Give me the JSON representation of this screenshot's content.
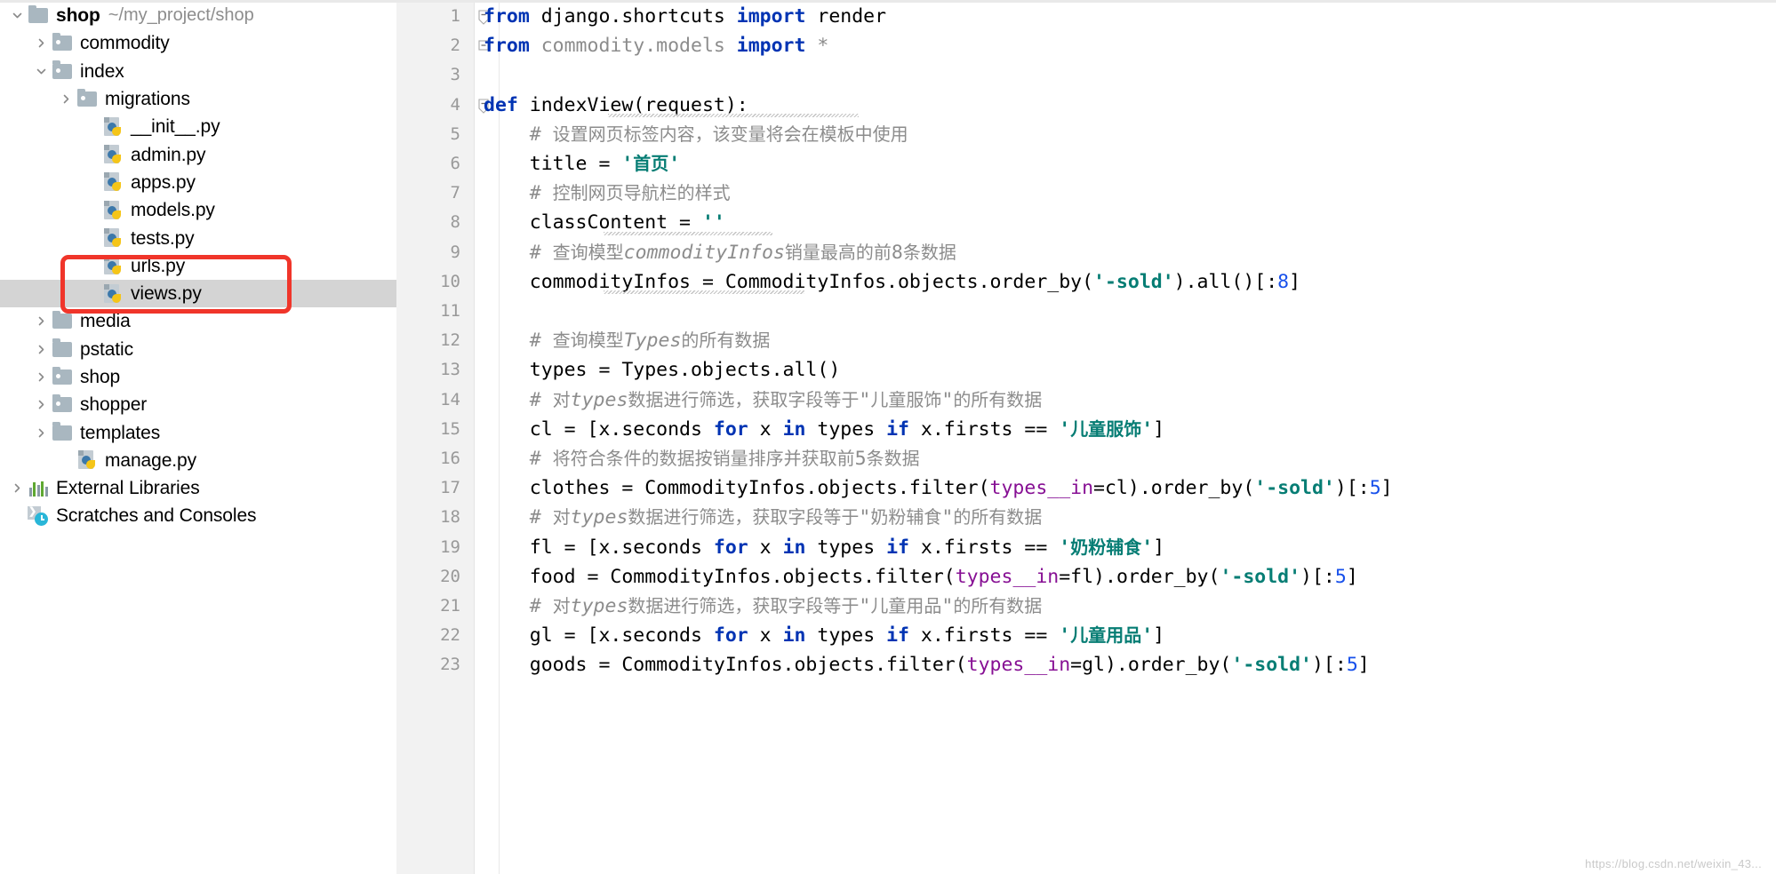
{
  "window": {
    "title": "PyCharm Project View with views.py editor"
  },
  "sidebar": {
    "items": [
      {
        "label": "shop",
        "path": "~/my_project/shop",
        "icon": "folder-icon",
        "arrow": "chevron-down-icon",
        "indent": 0,
        "bold": true,
        "selected": false,
        "type": "folder"
      },
      {
        "label": "commodity",
        "path": "",
        "icon": "source-folder-icon",
        "arrow": "chevron-right-icon",
        "indent": 1,
        "bold": false,
        "selected": false,
        "type": "source-folder"
      },
      {
        "label": "index",
        "path": "",
        "icon": "source-folder-icon",
        "arrow": "chevron-down-icon",
        "indent": 1,
        "bold": false,
        "selected": false,
        "type": "source-folder"
      },
      {
        "label": "migrations",
        "path": "",
        "icon": "source-folder-icon",
        "arrow": "chevron-right-icon",
        "indent": 2,
        "bold": false,
        "selected": false,
        "type": "source-folder"
      },
      {
        "label": "__init__.py",
        "path": "",
        "icon": "python-file-icon",
        "arrow": "none",
        "indent": 3,
        "bold": false,
        "selected": false,
        "type": "python-file"
      },
      {
        "label": "admin.py",
        "path": "",
        "icon": "python-file-icon",
        "arrow": "none",
        "indent": 3,
        "bold": false,
        "selected": false,
        "type": "python-file"
      },
      {
        "label": "apps.py",
        "path": "",
        "icon": "python-file-icon",
        "arrow": "none",
        "indent": 3,
        "bold": false,
        "selected": false,
        "type": "python-file"
      },
      {
        "label": "models.py",
        "path": "",
        "icon": "python-file-icon",
        "arrow": "none",
        "indent": 3,
        "bold": false,
        "selected": false,
        "type": "python-file"
      },
      {
        "label": "tests.py",
        "path": "",
        "icon": "python-file-icon",
        "arrow": "none",
        "indent": 3,
        "bold": false,
        "selected": false,
        "type": "python-file"
      },
      {
        "label": "urls.py",
        "path": "",
        "icon": "python-file-icon",
        "arrow": "none",
        "indent": 3,
        "bold": false,
        "selected": false,
        "type": "python-file"
      },
      {
        "label": "views.py",
        "path": "",
        "icon": "python-file-icon",
        "arrow": "none",
        "indent": 3,
        "bold": false,
        "selected": true,
        "type": "python-file"
      },
      {
        "label": "media",
        "path": "",
        "icon": "folder-icon",
        "arrow": "chevron-right-icon",
        "indent": 1,
        "bold": false,
        "selected": false,
        "type": "folder"
      },
      {
        "label": "pstatic",
        "path": "",
        "icon": "folder-icon",
        "arrow": "chevron-right-icon",
        "indent": 1,
        "bold": false,
        "selected": false,
        "type": "folder"
      },
      {
        "label": "shop",
        "path": "",
        "icon": "source-folder-icon",
        "arrow": "chevron-right-icon",
        "indent": 1,
        "bold": false,
        "selected": false,
        "type": "source-folder"
      },
      {
        "label": "shopper",
        "path": "",
        "icon": "source-folder-icon",
        "arrow": "chevron-right-icon",
        "indent": 1,
        "bold": false,
        "selected": false,
        "type": "source-folder"
      },
      {
        "label": "templates",
        "path": "",
        "icon": "folder-icon",
        "arrow": "chevron-right-icon",
        "indent": 1,
        "bold": false,
        "selected": false,
        "type": "folder"
      },
      {
        "label": "manage.py",
        "path": "",
        "icon": "python-file-icon",
        "arrow": "none",
        "indent": 2,
        "bold": false,
        "selected": false,
        "type": "python-file"
      },
      {
        "label": "External Libraries",
        "path": "",
        "icon": "external-libraries-icon",
        "arrow": "chevron-right-icon",
        "indent": 0,
        "bold": false,
        "selected": false,
        "type": "external-libraries"
      },
      {
        "label": "Scratches and Consoles",
        "path": "",
        "icon": "scratches-icon",
        "arrow": "none",
        "indent": 0,
        "bold": false,
        "selected": false,
        "type": "scratches"
      }
    ],
    "annotation": {
      "shape": "rectangle",
      "color": "#f0352a",
      "covers": [
        "urls.py",
        "views.py"
      ]
    }
  },
  "editor": {
    "line_numbers": [
      1,
      2,
      3,
      4,
      5,
      6,
      7,
      8,
      9,
      10,
      11,
      12,
      13,
      14,
      15,
      16,
      17,
      18,
      19,
      20,
      21,
      22,
      23
    ],
    "lines": [
      {
        "no": 1,
        "text": "from django.shortcuts import render",
        "fold": true
      },
      {
        "no": 2,
        "text": "from commodity.models import *",
        "fold": true
      },
      {
        "no": 3,
        "text": "",
        "fold": false
      },
      {
        "no": 4,
        "text": "def indexView(request):",
        "fold": true
      },
      {
        "no": 5,
        "text": "    # 设置网页标签内容，该变量将会在模板中使用",
        "fold": false
      },
      {
        "no": 6,
        "text": "    title = '首页'",
        "fold": false
      },
      {
        "no": 7,
        "text": "    # 控制网页导航栏的样式",
        "fold": false
      },
      {
        "no": 8,
        "text": "    classContent = ''",
        "fold": false
      },
      {
        "no": 9,
        "text": "    # 查询模型commodityInfos销量最高的前8条数据",
        "fold": false
      },
      {
        "no": 10,
        "text": "    commodityInfos = CommodityInfos.objects.order_by('-sold').all()[:8]",
        "fold": false
      },
      {
        "no": 11,
        "text": "",
        "fold": false
      },
      {
        "no": 12,
        "text": "    # 查询模型Types的所有数据",
        "fold": false
      },
      {
        "no": 13,
        "text": "    types = Types.objects.all()",
        "fold": false
      },
      {
        "no": 14,
        "text": "    # 对types数据进行筛选，获取字段等于\"儿童服饰\"的所有数据",
        "fold": false
      },
      {
        "no": 15,
        "text": "    cl = [x.seconds for x in types if x.firsts == '儿童服饰']",
        "fold": false
      },
      {
        "no": 16,
        "text": "    # 将符合条件的数据按销量排序并获取前5条数据",
        "fold": false
      },
      {
        "no": 17,
        "text": "    clothes = CommodityInfos.objects.filter(types__in=cl).order_by('-sold')[:5]",
        "fold": false
      },
      {
        "no": 18,
        "text": "    # 对types数据进行筛选，获取字段等于\"奶粉辅食\"的所有数据",
        "fold": false
      },
      {
        "no": 19,
        "text": "    fl = [x.seconds for x in types if x.firsts == '奶粉辅食']",
        "fold": false
      },
      {
        "no": 20,
        "text": "    food = CommodityInfos.objects.filter(types__in=fl).order_by('-sold')[:5]",
        "fold": false
      },
      {
        "no": 21,
        "text": "    # 对types数据进行筛选，获取字段等于\"儿童用品\"的所有数据",
        "fold": false
      },
      {
        "no": 22,
        "text": "    gl = [x.seconds for x in types if x.firsts == '儿童用品']",
        "fold": false
      },
      {
        "no": 23,
        "text": "    goods = CommodityInfos.objects.filter(types__in=gl).order_by('-sold')[:5]",
        "fold": false
      }
    ],
    "watermark": "https://blog.csdn.net/weixin_43...",
    "colors": {
      "keyword": "#0033b3",
      "string": "#067d74",
      "number": "#1750eb",
      "comment": "#8c8c8c",
      "kwarg": "#871094",
      "gutter_bg": "#f2f2f2",
      "selection": "#d4d4d4"
    }
  }
}
